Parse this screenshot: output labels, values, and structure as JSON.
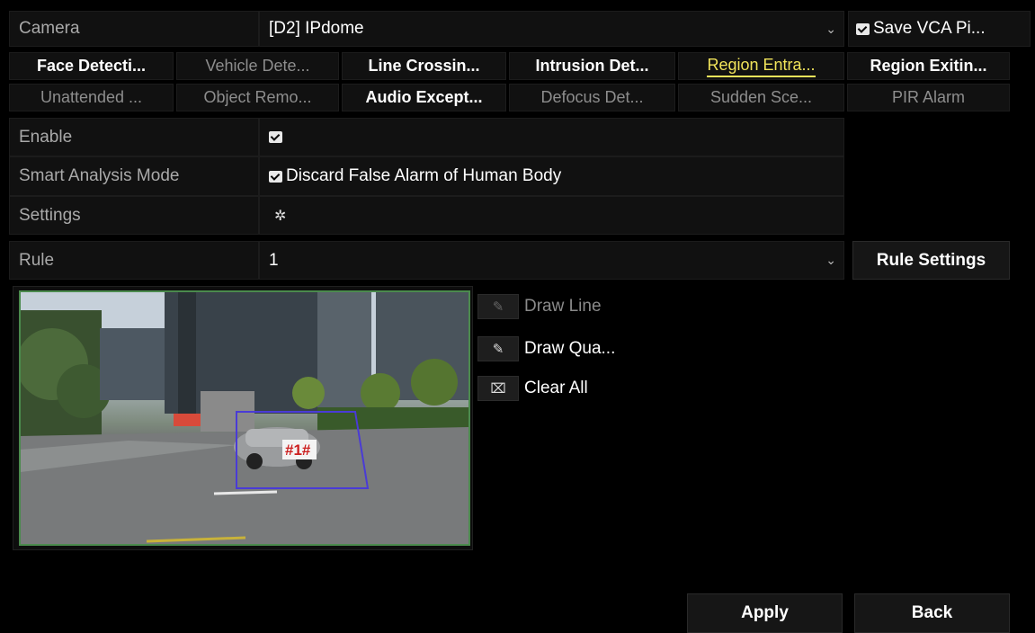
{
  "camera": {
    "label": "Camera",
    "value": "[D2] IPdome",
    "arrow": "⌄"
  },
  "save_vca": {
    "label": "Save VCA Pi..."
  },
  "tabs_row1": [
    {
      "label": "Face Detecti...",
      "state": "on"
    },
    {
      "label": "Vehicle Dete...",
      "state": "off"
    },
    {
      "label": "Line Crossin...",
      "state": "on"
    },
    {
      "label": "Intrusion Det...",
      "state": "on"
    },
    {
      "label": "Region Entra...",
      "state": "active"
    },
    {
      "label": "Region Exitin...",
      "state": "on"
    }
  ],
  "tabs_row2": [
    {
      "label": "Unattended ...",
      "state": "off"
    },
    {
      "label": "Object Remo...",
      "state": "off"
    },
    {
      "label": "Audio Except...",
      "state": "on"
    },
    {
      "label": "Defocus Det...",
      "state": "off"
    },
    {
      "label": "Sudden Sce...",
      "state": "off"
    },
    {
      "label": "PIR Alarm",
      "state": "off"
    }
  ],
  "enable": {
    "label": "Enable"
  },
  "smart": {
    "label": "Smart Analysis Mode",
    "option": "Discard False Alarm of Human Body"
  },
  "settings": {
    "label": "Settings",
    "icon": "gear-icon"
  },
  "rule": {
    "label": "Rule",
    "value": "1",
    "arrow": "⌄",
    "button": "Rule Settings"
  },
  "tools": {
    "draw_line": "Draw Line",
    "draw_quad": "Draw Qua...",
    "clear_all": "Clear All"
  },
  "region_label": "#1#",
  "buttons": {
    "apply": "Apply",
    "back": "Back"
  },
  "colors": {
    "active_tab": "#f0e35a",
    "region_box": "#4a3bd6",
    "preview_border": "#4b8a4d"
  }
}
